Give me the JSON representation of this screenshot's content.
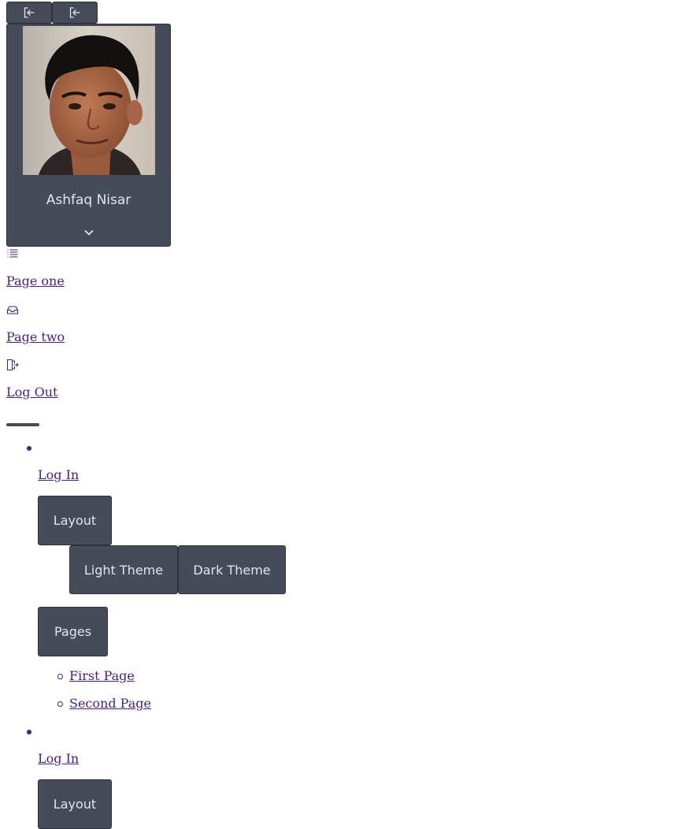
{
  "top_buttons": [
    {
      "icon": "box-arrow-in-left-icon"
    },
    {
      "icon": "box-arrow-in-left-icon"
    }
  ],
  "profile": {
    "name": "Ashfaq Nisar",
    "toggle_icon": "chevron-down-icon"
  },
  "side_nav": [
    {
      "label": "Page one",
      "icon": "list-icon"
    },
    {
      "label": "Page two",
      "icon": "inbox-icon"
    },
    {
      "label": "Log Out",
      "icon": "door-open-icon"
    }
  ],
  "menu_groups": [
    {
      "login_label": "Log In",
      "layout_label": "Layout",
      "themes": [
        "Light Theme",
        "Dark Theme"
      ],
      "pages_label": "Pages",
      "pages": [
        "First Page",
        "Second Page"
      ]
    },
    {
      "login_label": "Log In",
      "layout_label": "Layout"
    }
  ],
  "colors": {
    "button_bg": "#464b5a",
    "button_text": "#e3e5ea",
    "link": "#4b1f7a"
  }
}
